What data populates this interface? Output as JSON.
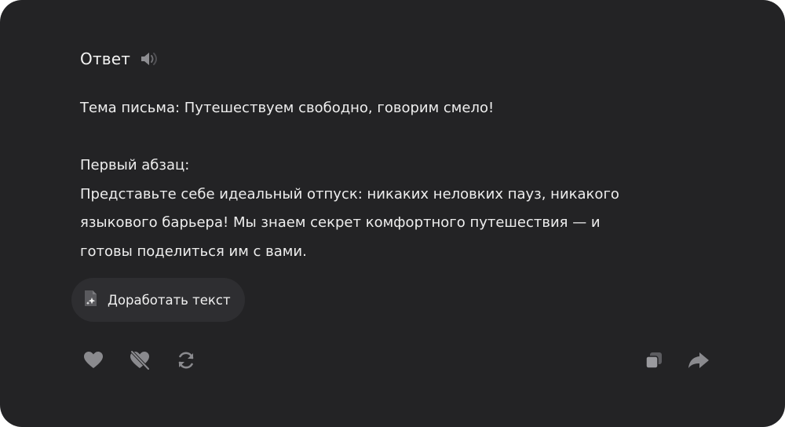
{
  "card": {
    "title": "Ответ",
    "speaker_icon": "speaker-icon"
  },
  "message": {
    "subject": "Тема письма: Путешествуем свободно, говорим смело!",
    "paragraph_heading": "Первый абзац:",
    "paragraph_lines": [
      "Представьте себе идеальный отпуск: никаких неловких пауз, никакого",
      "языкового барьера! Мы знаем секрет комфортного путешествия — и",
      "готовы поделиться им с вами."
    ]
  },
  "refine_button": {
    "label": "Доработать текст",
    "icon": "sparkle-document-icon"
  },
  "actions": {
    "left": [
      "like-icon",
      "dislike-icon",
      "regenerate-icon"
    ],
    "right": [
      "copy-icon",
      "share-icon"
    ]
  },
  "colors": {
    "background": "#232325",
    "text": "#eeeeee",
    "button_bg": "#2e2e31",
    "icon": "#8a8a8e"
  }
}
